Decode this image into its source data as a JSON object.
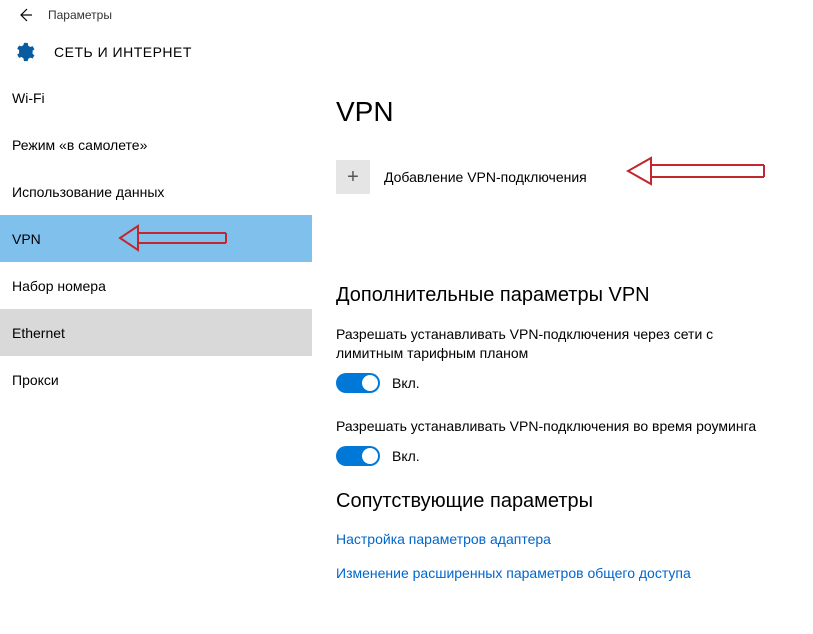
{
  "titlebar": {
    "title": "Параметры"
  },
  "header": {
    "section": "СЕТЬ И ИНТЕРНЕТ"
  },
  "sidebar": {
    "items": [
      {
        "label": "Wi-Fi"
      },
      {
        "label": "Режим «в самолете»"
      },
      {
        "label": "Использование данных"
      },
      {
        "label": "VPN"
      },
      {
        "label": "Набор номера"
      },
      {
        "label": "Ethernet"
      },
      {
        "label": "Прокси"
      }
    ]
  },
  "page": {
    "title": "VPN",
    "add_label": "Добавление VPN-подключения",
    "advanced_heading": "Дополнительные параметры VPN",
    "setting1_text": "Разрешать устанавливать VPN-подключения через сети с лимитным тарифным планом",
    "setting2_text": "Разрешать устанавливать VPN-подключения во время роуминга",
    "toggle_on_label": "Вкл.",
    "related_heading": "Сопутствующие параметры",
    "link1": "Настройка параметров адаптера",
    "link2": "Изменение расширенных параметров общего доступа"
  }
}
